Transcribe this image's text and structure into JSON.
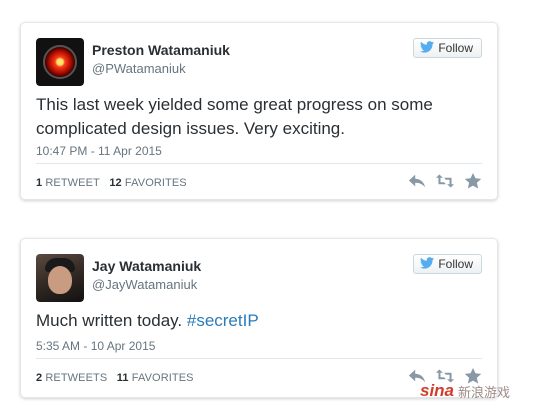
{
  "tweets": [
    {
      "display_name": "Preston Watamaniuk",
      "handle": "@PWatamaniuk",
      "follow_label": "Follow",
      "text": "This last week yielded some great progress on some complicated design issues.  Very exciting.",
      "timestamp": "10:47 PM - 11 Apr 2015",
      "retweets_count": "1",
      "retweets_label": "RETWEET",
      "favorites_count": "12",
      "favorites_label": "FAVORITES"
    },
    {
      "display_name": "Jay Watamaniuk",
      "handle": "@JayWatamaniuk",
      "follow_label": "Follow",
      "text_plain": "Much written today. ",
      "text_hashtag": "#secretIP",
      "timestamp": "5:35 AM - 10 Apr 2015",
      "retweets_count": "2",
      "retweets_label": "RETWEETS",
      "favorites_count": "11",
      "favorites_label": "FAVORITES"
    }
  ],
  "watermark": {
    "logo": "sina",
    "text": "新浪游戏"
  },
  "colors": {
    "link": "#2b7bb9",
    "muted": "#66757f",
    "icon": "#8899a6",
    "border": "#e1e8ed"
  },
  "icons": [
    "twitter-bird-icon",
    "reply-icon",
    "retweet-icon",
    "favorite-star-icon"
  ]
}
